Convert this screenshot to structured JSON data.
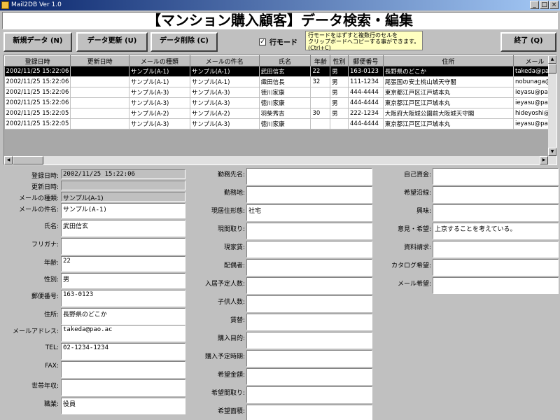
{
  "window": {
    "title": "Mail2DB Ver 1.0",
    "min": "_",
    "max": "□",
    "close": "×"
  },
  "banner": "【マンション購入顧客】データ検索・編集",
  "toolbar": {
    "new_label": "新規データ (N)",
    "update_label": "データ更新 (U)",
    "delete_label": "データ削除 (C)",
    "row_mode_label": "行モード",
    "row_mode_checked": "✓",
    "hint_line1": "行モードをはずすと複数行のセルを",
    "hint_line2": "クリップボードへコピーする事ができます。",
    "hint_line3": "(Ctrl+C)",
    "exit_label": "終了 (Q)"
  },
  "grid": {
    "columns": [
      "登録日時",
      "更新日時",
      "メールの種類",
      "メールの件名",
      "氏名",
      "年齢",
      "性別",
      "郵便番号",
      "住所",
      "メール"
    ],
    "rows": [
      [
        "2002/11/25 15:22:06",
        "",
        "サンプル(A-1)",
        "サンプル(A-1)",
        "武田信玄",
        "22",
        "男",
        "163-0123",
        "長野県のどこか",
        "takeda@pao"
      ],
      [
        "2002/11/25 15:22:06",
        "",
        "サンプル(A-1)",
        "サンプル(A-1)",
        "織田信長",
        "32",
        "男",
        "111-1234",
        "尾張国の安土桃山城天守閣",
        "nobunaga@"
      ],
      [
        "2002/11/25 15:22:06",
        "",
        "サンプル(A-3)",
        "サンプル(A-3)",
        "徳川家康",
        "",
        "男",
        "444-4444",
        "東京都江戸区江戸城本丸",
        "ieyasu@pao"
      ],
      [
        "2002/11/25 15:22:06",
        "",
        "サンプル(A-3)",
        "サンプル(A-3)",
        "徳川家康",
        "",
        "男",
        "444-4444",
        "東京都江戸区江戸城本丸",
        "ieyasu@pao"
      ],
      [
        "2002/11/25 15:22:05",
        "",
        "サンプル(A-2)",
        "サンプル(A-2)",
        "羽柴秀吉",
        "30",
        "男",
        "222-1234",
        "大阪府大阪城公園前大阪城天守閣",
        "hideyoshi@"
      ],
      [
        "2002/11/25 15:22:05",
        "",
        "サンプル(A-3)",
        "サンプル(A-3)",
        "徳川家康",
        "",
        "",
        "444-4444",
        "東京都江戸区江戸城本丸",
        "ieyasu@pao"
      ]
    ]
  },
  "form": {
    "col1": [
      {
        "label": "登録日時:",
        "value": "2002/11/25 15:22:06"
      },
      {
        "label": "更新日時:",
        "value": ""
      },
      {
        "label": "メールの種類:",
        "value": "サンプル(A-1)"
      },
      {
        "label": "メールの件名:",
        "value": "サンプル(A-1)"
      },
      {
        "label": "氏名:",
        "value": "武田信玄"
      },
      {
        "label": "フリガナ:",
        "value": ""
      },
      {
        "label": "年齢:",
        "value": "22"
      },
      {
        "label": "性別:",
        "value": "男"
      },
      {
        "label": "郵便番号:",
        "value": "163-0123"
      },
      {
        "label": "住所:",
        "value": "長野県のどこか"
      },
      {
        "label": "メールアドレス:",
        "value": "takeda@pao.ac"
      },
      {
        "label": "TEL:",
        "value": "02-1234-1234"
      },
      {
        "label": "FAX:",
        "value": ""
      },
      {
        "label": "世帯年収:",
        "value": ""
      },
      {
        "label": "職業:",
        "value": "役員"
      }
    ],
    "col2": [
      {
        "label": "勤務先名:",
        "value": ""
      },
      {
        "label": "勤務地:",
        "value": ""
      },
      {
        "label": "現居住形態:",
        "value": "社宅"
      },
      {
        "label": "現間取り:",
        "value": ""
      },
      {
        "label": "現家賃:",
        "value": ""
      },
      {
        "label": "配偶者:",
        "value": ""
      },
      {
        "label": "入居予定人数:",
        "value": ""
      },
      {
        "label": "子供人数:",
        "value": ""
      },
      {
        "label": "賃替:",
        "value": ""
      },
      {
        "label": "購入目的:",
        "value": ""
      },
      {
        "label": "購入予定時期:",
        "value": ""
      },
      {
        "label": "希望金額:",
        "value": ""
      },
      {
        "label": "希望間取り:",
        "value": ""
      },
      {
        "label": "希望面積:",
        "value": ""
      }
    ],
    "col3": [
      {
        "label": "自己資金:",
        "value": ""
      },
      {
        "label": "希望沿線:",
        "value": ""
      },
      {
        "label": "興味:",
        "value": ""
      },
      {
        "label": "意見・希望:",
        "value": "上京することを考えている。"
      },
      {
        "label": "資料請求:",
        "value": ""
      },
      {
        "label": "カタログ希望:",
        "value": ""
      },
      {
        "label": "メール希望:",
        "value": ""
      }
    ]
  }
}
